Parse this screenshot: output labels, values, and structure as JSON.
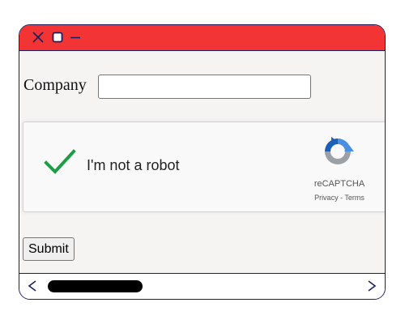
{
  "window": {
    "titlebar_color": "#f23434",
    "border_color": "#1d1d5c",
    "controls": {
      "close_icon": "close-icon",
      "maximize_icon": "maximize-icon",
      "minimize_icon": "minimize-icon"
    }
  },
  "form": {
    "company_label": "Company",
    "company_value": "",
    "submit_label": "Submit"
  },
  "recaptcha": {
    "checkbox_label": "I'm not a robot",
    "checked": true,
    "check_color": "#1e9c48",
    "brand": "reCAPTCHA",
    "privacy_label": "Privacy",
    "separator": " - ",
    "terms_label": "Terms"
  },
  "scrollbar": {
    "left_arrow": "<",
    "right_arrow": ">"
  }
}
